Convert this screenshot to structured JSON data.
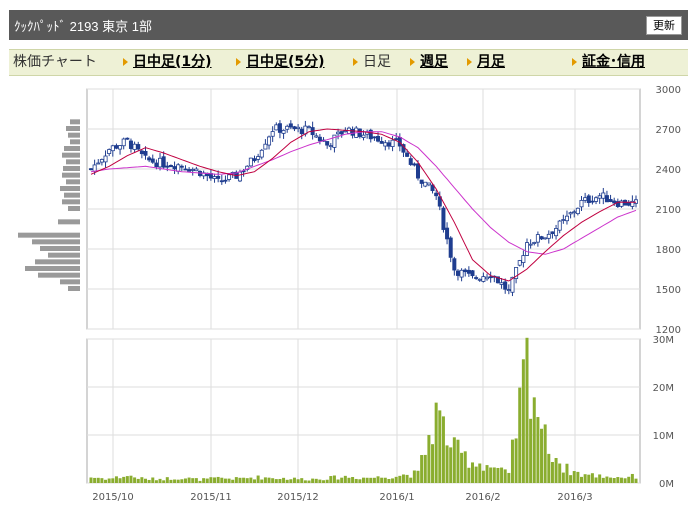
{
  "header": {
    "title": "ｸｯｸﾊﾟｯﾄﾞ 2193 東京 1部",
    "refresh_label": "更新"
  },
  "nav": {
    "chart_label": "株価チャート",
    "items": [
      {
        "label": "日中足(1分)",
        "link": true
      },
      {
        "label": "日中足(5分)",
        "link": true
      },
      {
        "label": "日足",
        "link": false
      },
      {
        "label": "週足",
        "link": true
      },
      {
        "label": "月足",
        "link": true
      },
      {
        "label": "証金･信用",
        "link": true
      }
    ]
  },
  "colors": {
    "candle": "#1f3d8f",
    "ma_short": "#c00040",
    "ma_long": "#cc33cc",
    "volume": "#8aad2f",
    "volume_profile": "#9a9a9a",
    "grid": "#dddddd",
    "nav_bg": "#eef1d6",
    "nav_arrow": "#e39a00"
  },
  "chart_data": {
    "type": "candlestick",
    "price_axis": {
      "min": 1200,
      "max": 3000,
      "ticks": [
        "3000",
        "2700",
        "2400",
        "2100",
        "1800",
        "1500",
        "1200"
      ]
    },
    "volume_axis": {
      "min": 0,
      "max": 30,
      "unit": "M",
      "ticks": [
        "30M",
        "20M",
        "10M",
        "0M"
      ]
    },
    "month_labels": [
      "2015/10",
      "2015/11",
      "2015/12",
      "2016/1",
      "2016/2",
      "2016/3"
    ],
    "grid": true,
    "weekly_closes": [
      2400,
      2550,
      2610,
      2470,
      2440,
      2430,
      2380,
      2300,
      2350,
      2480,
      2700,
      2700,
      2690,
      2580,
      2700,
      2660,
      2620,
      2580,
      2350,
      2200,
      1650,
      1580,
      1620,
      1480,
      1850,
      1900,
      2000,
      2150,
      2200,
      2150,
      2140
    ],
    "ma_short": [
      2360,
      2420,
      2500,
      2560,
      2520,
      2470,
      2420,
      2380,
      2350,
      2380,
      2480,
      2600,
      2680,
      2700,
      2690,
      2680,
      2660,
      2600,
      2450,
      2250,
      2000,
      1720,
      1600,
      1560,
      1650,
      1780,
      1900,
      2000,
      2080,
      2150,
      2150
    ],
    "ma_long": [
      2380,
      2400,
      2410,
      2420,
      2400,
      2380,
      2370,
      2360,
      2370,
      2420,
      2470,
      2530,
      2580,
      2620,
      2660,
      2680,
      2680,
      2640,
      2560,
      2420,
      2260,
      2100,
      1960,
      1850,
      1780,
      1760,
      1800,
      1880,
      1960,
      2040,
      2090
    ],
    "weekly_volume_M": [
      1.2,
      0.9,
      1.5,
      0.8,
      0.9,
      1.1,
      0.7,
      1.0,
      0.9,
      1.2,
      1.1,
      0.9,
      0.8,
      1.0,
      1.3,
      1.1,
      1.2,
      1.6,
      2.0,
      14.5,
      7.0,
      4.5,
      3.5,
      1.8,
      25.5,
      9.0,
      3.2,
      1.8,
      1.5,
      1.2,
      1.4
    ],
    "volume_profile": [
      {
        "price": 2750,
        "volume": 10
      },
      {
        "price": 2700,
        "volume": 14
      },
      {
        "price": 2650,
        "volume": 12
      },
      {
        "price": 2600,
        "volume": 10
      },
      {
        "price": 2550,
        "volume": 16
      },
      {
        "price": 2500,
        "volume": 18
      },
      {
        "price": 2450,
        "volume": 14
      },
      {
        "price": 2400,
        "volume": 17
      },
      {
        "price": 2350,
        "volume": 18
      },
      {
        "price": 2300,
        "volume": 14
      },
      {
        "price": 2250,
        "volume": 20
      },
      {
        "price": 2200,
        "volume": 16
      },
      {
        "price": 2150,
        "volume": 18
      },
      {
        "price": 2100,
        "volume": 12
      },
      {
        "price": 2000,
        "volume": 22
      },
      {
        "price": 1900,
        "volume": 62
      },
      {
        "price": 1850,
        "volume": 48
      },
      {
        "price": 1800,
        "volume": 40
      },
      {
        "price": 1750,
        "volume": 32
      },
      {
        "price": 1700,
        "volume": 45
      },
      {
        "price": 1650,
        "volume": 55
      },
      {
        "price": 1600,
        "volume": 42
      },
      {
        "price": 1550,
        "volume": 20
      },
      {
        "price": 1500,
        "volume": 12
      }
    ]
  }
}
